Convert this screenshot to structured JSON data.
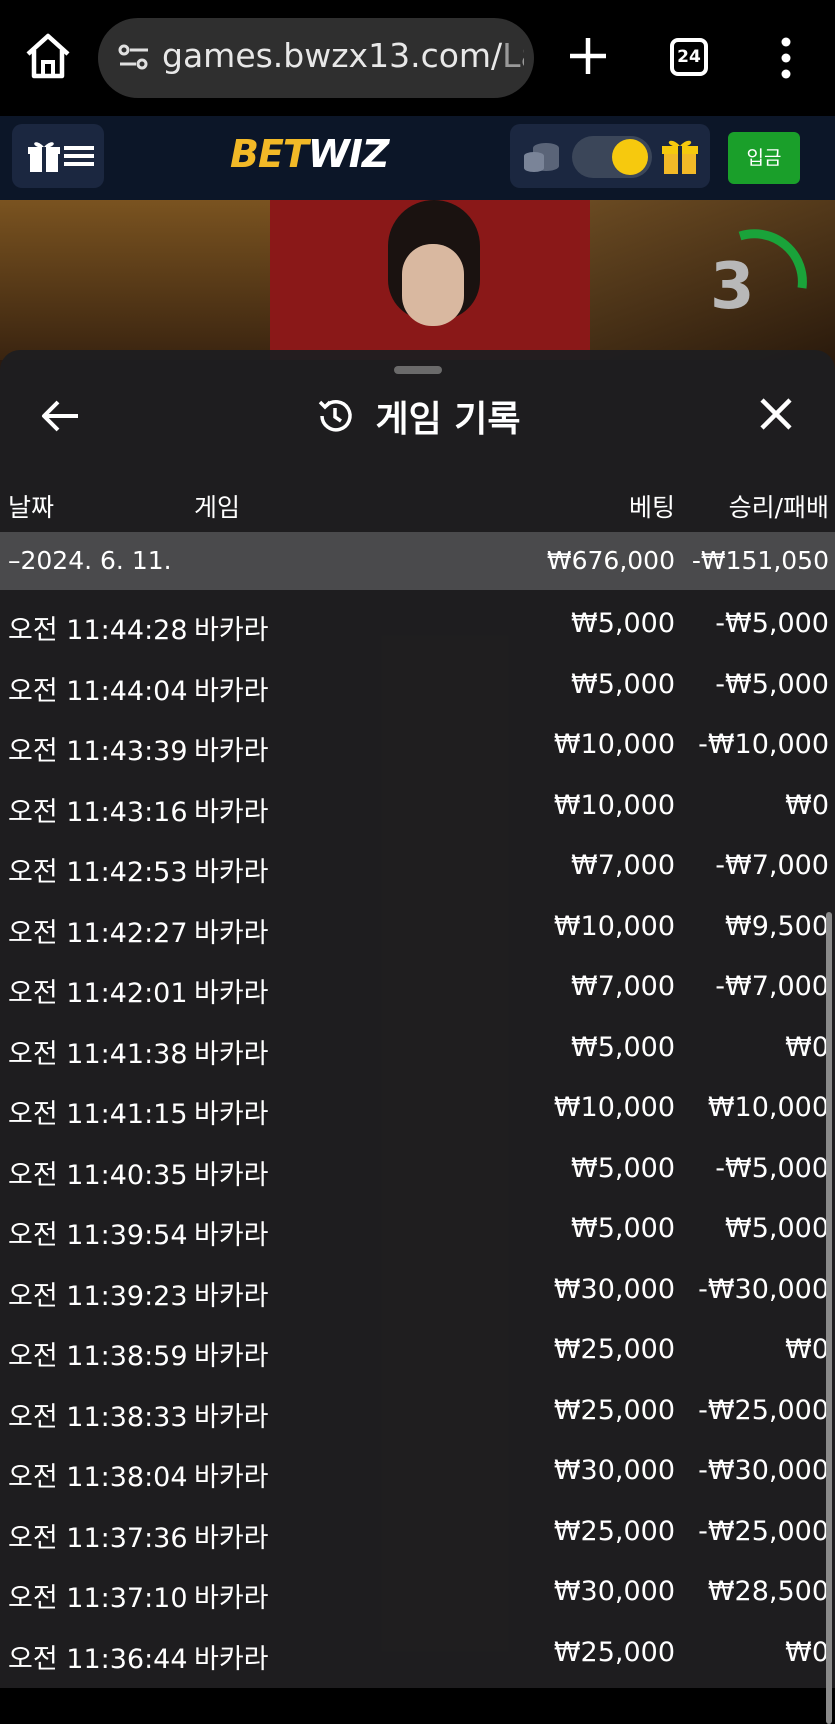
{
  "browser": {
    "url_main": "games.bwzx13.com/",
    "url_tail": "La",
    "tab_count": "24"
  },
  "header": {
    "logo_part1": "BET",
    "logo_part2": "WIZ",
    "deposit_label": "입금"
  },
  "video": {
    "countdown": "3"
  },
  "history": {
    "title": "게임 기록",
    "columns": {
      "date": "날짜",
      "game": "게임",
      "bet": "베팅",
      "win_loss": "승리/패배"
    },
    "group": {
      "date": "–2024. 6. 11.",
      "bet_total": "₩676,000",
      "win_loss_total": "-₩151,050"
    },
    "rows": [
      {
        "time": "오전 11:44:28",
        "game": "바카라",
        "bet": "₩5,000",
        "win_loss": "-₩5,000"
      },
      {
        "time": "오전 11:44:04",
        "game": "바카라",
        "bet": "₩5,000",
        "win_loss": "-₩5,000"
      },
      {
        "time": "오전 11:43:39",
        "game": "바카라",
        "bet": "₩10,000",
        "win_loss": "-₩10,000"
      },
      {
        "time": "오전 11:43:16",
        "game": "바카라",
        "bet": "₩10,000",
        "win_loss": "₩0"
      },
      {
        "time": "오전 11:42:53",
        "game": "바카라",
        "bet": "₩7,000",
        "win_loss": "-₩7,000"
      },
      {
        "time": "오전 11:42:27",
        "game": "바카라",
        "bet": "₩10,000",
        "win_loss": "₩9,500"
      },
      {
        "time": "오전 11:42:01",
        "game": "바카라",
        "bet": "₩7,000",
        "win_loss": "-₩7,000"
      },
      {
        "time": "오전 11:41:38",
        "game": "바카라",
        "bet": "₩5,000",
        "win_loss": "₩0"
      },
      {
        "time": "오전 11:41:15",
        "game": "바카라",
        "bet": "₩10,000",
        "win_loss": "₩10,000"
      },
      {
        "time": "오전 11:40:35",
        "game": "바카라",
        "bet": "₩5,000",
        "win_loss": "-₩5,000"
      },
      {
        "time": "오전 11:39:54",
        "game": "바카라",
        "bet": "₩5,000",
        "win_loss": "₩5,000"
      },
      {
        "time": "오전 11:39:23",
        "game": "바카라",
        "bet": "₩30,000",
        "win_loss": "-₩30,000"
      },
      {
        "time": "오전 11:38:59",
        "game": "바카라",
        "bet": "₩25,000",
        "win_loss": "₩0"
      },
      {
        "time": "오전 11:38:33",
        "game": "바카라",
        "bet": "₩25,000",
        "win_loss": "-₩25,000"
      },
      {
        "time": "오전 11:38:04",
        "game": "바카라",
        "bet": "₩30,000",
        "win_loss": "-₩30,000"
      },
      {
        "time": "오전 11:37:36",
        "game": "바카라",
        "bet": "₩25,000",
        "win_loss": "-₩25,000"
      },
      {
        "time": "오전 11:37:10",
        "game": "바카라",
        "bet": "₩30,000",
        "win_loss": "₩28,500"
      },
      {
        "time": "오전 11:36:44",
        "game": "바카라",
        "bet": "₩25,000",
        "win_loss": "₩0"
      }
    ]
  }
}
